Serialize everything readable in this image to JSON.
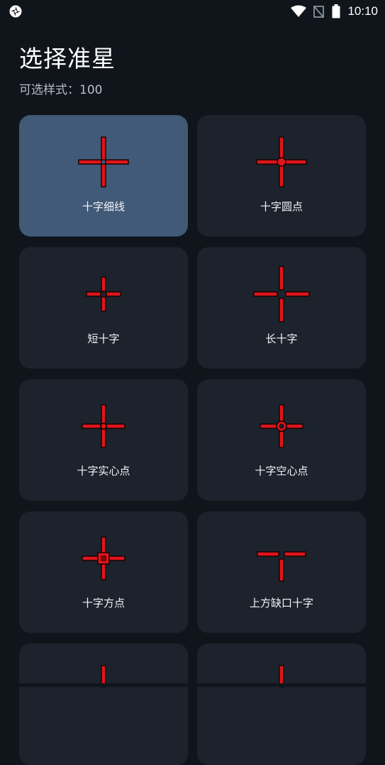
{
  "status_bar": {
    "time": "10:10",
    "icons": [
      "app-status-icon",
      "wifi-icon",
      "no-signal-icon",
      "battery-icon"
    ]
  },
  "header": {
    "title": "选择准星",
    "subtitle": "可选样式：100"
  },
  "colors": {
    "background": "#10151c",
    "card": "#1c232d",
    "card_selected": "#415a78",
    "crosshair_red": "#e0141a",
    "crosshair_outline": "#160404"
  },
  "crosshairs": [
    {
      "label": "十字细线",
      "selected": true
    },
    {
      "label": "十字圆点",
      "selected": false
    },
    {
      "label": "短十字",
      "selected": false
    },
    {
      "label": "长十字",
      "selected": false
    },
    {
      "label": "十字实心点",
      "selected": false
    },
    {
      "label": "十字空心点",
      "selected": false
    },
    {
      "label": "十字方点",
      "selected": false
    },
    {
      "label": "上方缺口十字",
      "selected": false
    },
    {
      "label": "",
      "selected": false
    },
    {
      "label": "",
      "selected": false
    }
  ]
}
